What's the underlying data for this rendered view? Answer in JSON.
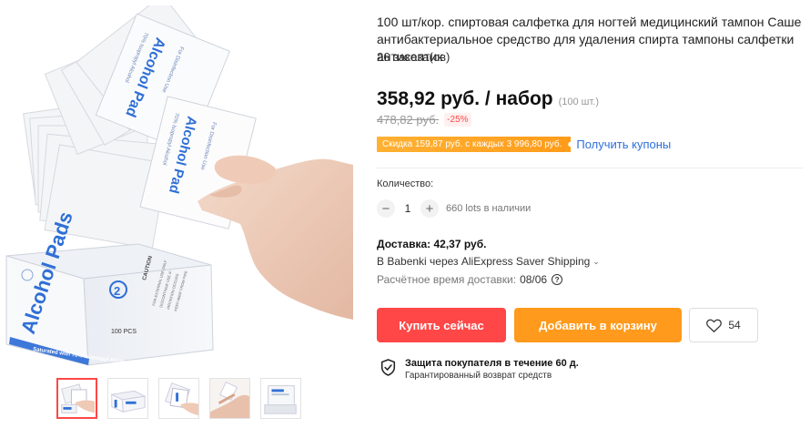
{
  "gallery": {
    "main_image": {
      "box_brand": "Alcohol Pads",
      "box_count": "100 PCS",
      "box_strip": "Saturated with 70% Isopropyl Alcohol",
      "box_number": "2",
      "box_caution": "CAUTION",
      "box_caution_lines": [
        "FOR EXTERNAL USE ONLY",
        "DISCONTINUE USE IF",
        "IRRITATION OCCURS",
        "KEEP AWAY FROM FIRE"
      ],
      "pad_brand": "Alcohol Pad",
      "pad_sub": "70% Isopropyl Alcohol",
      "pad_use": "For Disinfection Use"
    },
    "thumbnails": [
      {
        "name": "thumb-1",
        "active": true
      },
      {
        "name": "thumb-2",
        "active": false
      },
      {
        "name": "thumb-3",
        "active": false
      },
      {
        "name": "thumb-4",
        "active": false
      },
      {
        "name": "thumb-5",
        "active": false
      }
    ]
  },
  "product": {
    "title": "100 шт/кор. спиртовая салфетка для ногтей медицинский тампон Саше антибактериальное средство для удаления спирта тампоны салфетки антисептик",
    "orders": "26 заказа(ов)",
    "price": "358,92 руб. / набор",
    "price_unit": "(100 шт.)",
    "old_price": "478,82 руб.",
    "discount": "-25%",
    "coupon_badge": "Скидка 159,87 руб. с каждых 3 996,80 руб.",
    "coupon_link": "Получить купоны"
  },
  "quantity": {
    "label": "Количество:",
    "minus": "−",
    "value": "1",
    "plus": "+",
    "stock": "660 lots в наличии"
  },
  "shipping": {
    "title": "Доставка: 42,37 руб.",
    "route": "В Babenki через AliExpress Saver Shipping",
    "chevron": "⌄",
    "time_label": "Расчётное время доставки:",
    "time_value": "08/06",
    "help": "?"
  },
  "actions": {
    "buy": "Купить сейчас",
    "cart": "Добавить в корзину",
    "wish_count": "54"
  },
  "protection": {
    "title": "Защита покупателя в течение 60 д.",
    "subtitle": "Гарантированный возврат средств"
  },
  "colors": {
    "buy": "#ff4747",
    "cart": "#ff9a1c",
    "coupon": "#ff9c1a",
    "link": "#2e6fd9",
    "box_blue": "#2f6fd6"
  },
  "icons": {
    "heart": "heart-icon",
    "shield": "shield-check-icon",
    "help": "help-circle-icon",
    "chevron": "chevron-down-icon"
  }
}
